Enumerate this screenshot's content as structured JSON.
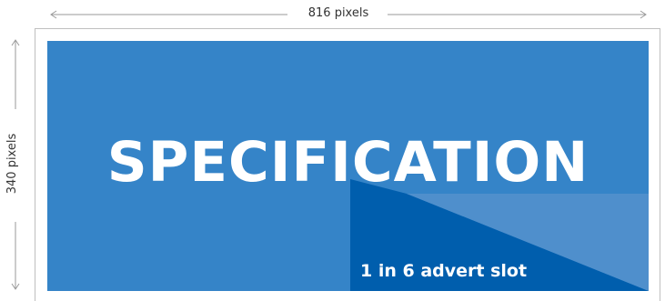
{
  "dimensions": {
    "width_label": "816 pixels",
    "height_label": "340 pixels"
  },
  "banner": {
    "title": "SPECIFICATION",
    "slot_label": "1 in 6 advert slot"
  },
  "colors": {
    "banner_blue": "#3584c8",
    "slot_blue": "#005ead",
    "slot_tint": "#4f8fcc",
    "text": "#ffffff",
    "dimension_line": "#9a9a9a",
    "dimension_text": "#333333"
  }
}
